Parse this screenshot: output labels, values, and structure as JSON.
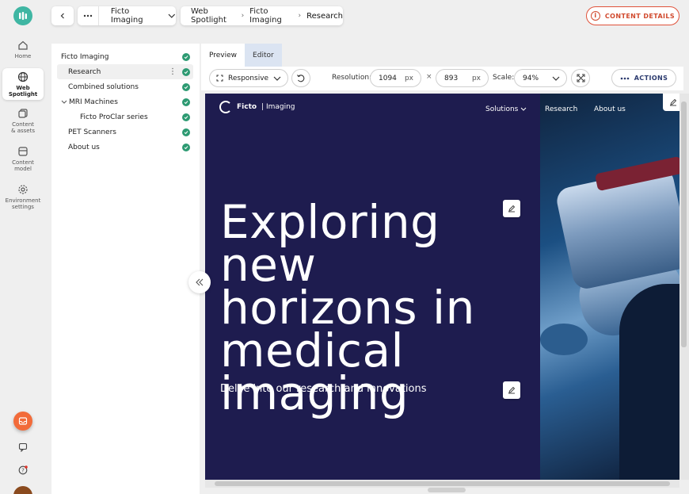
{
  "rail": {
    "items": [
      {
        "label_line1": "Home",
        "label_line2": "",
        "icon": "home-icon"
      },
      {
        "label_line1": "Web",
        "label_line2": "Spotlight",
        "icon": "globe-icon"
      },
      {
        "label_line1": "Content",
        "label_line2": "& assets",
        "icon": "content-icon"
      },
      {
        "label_line1": "Content",
        "label_line2": "model",
        "icon": "model-icon"
      },
      {
        "label_line1": "Environment",
        "label_line2": "settings",
        "icon": "gear-icon"
      }
    ]
  },
  "topbar": {
    "collection_name": "Ficto Imaging",
    "breadcrumb": [
      "Web Spotlight",
      "Ficto Imaging",
      "Research"
    ],
    "content_details_label": "CONTENT DETAILS"
  },
  "tree": {
    "items": [
      {
        "label": "Ficto Imaging"
      },
      {
        "label": "Research"
      },
      {
        "label": "Combined solutions"
      },
      {
        "label": "MRI Machines"
      },
      {
        "label": "Ficto ProClar series"
      },
      {
        "label": "PET Scanners"
      },
      {
        "label": "About us"
      }
    ]
  },
  "tabs": {
    "preview": "Preview",
    "editor": "Editor"
  },
  "toolbar": {
    "responsive": "Responsive",
    "resolution_label": "Resolution:",
    "width": "1094",
    "height": "893",
    "unit": "px",
    "times": "×",
    "scale_label": "Scale:",
    "scale": "94%",
    "actions": "ACTIONS"
  },
  "preview": {
    "brand_name": "Ficto",
    "brand_suffix": "| Imaging",
    "nav": [
      "Solutions",
      "Research",
      "About us"
    ],
    "hero_line1": "Exploring new",
    "hero_line2": "horizons in",
    "hero_line3": "medical",
    "hero_line4": "imaging",
    "subtitle": "Delve into our research and innovations"
  },
  "colors": {
    "accent": "#3fb6a3",
    "danger": "#d14a2e",
    "hero_bg": "#1e1c4f",
    "status_ok": "#2d9a72"
  }
}
